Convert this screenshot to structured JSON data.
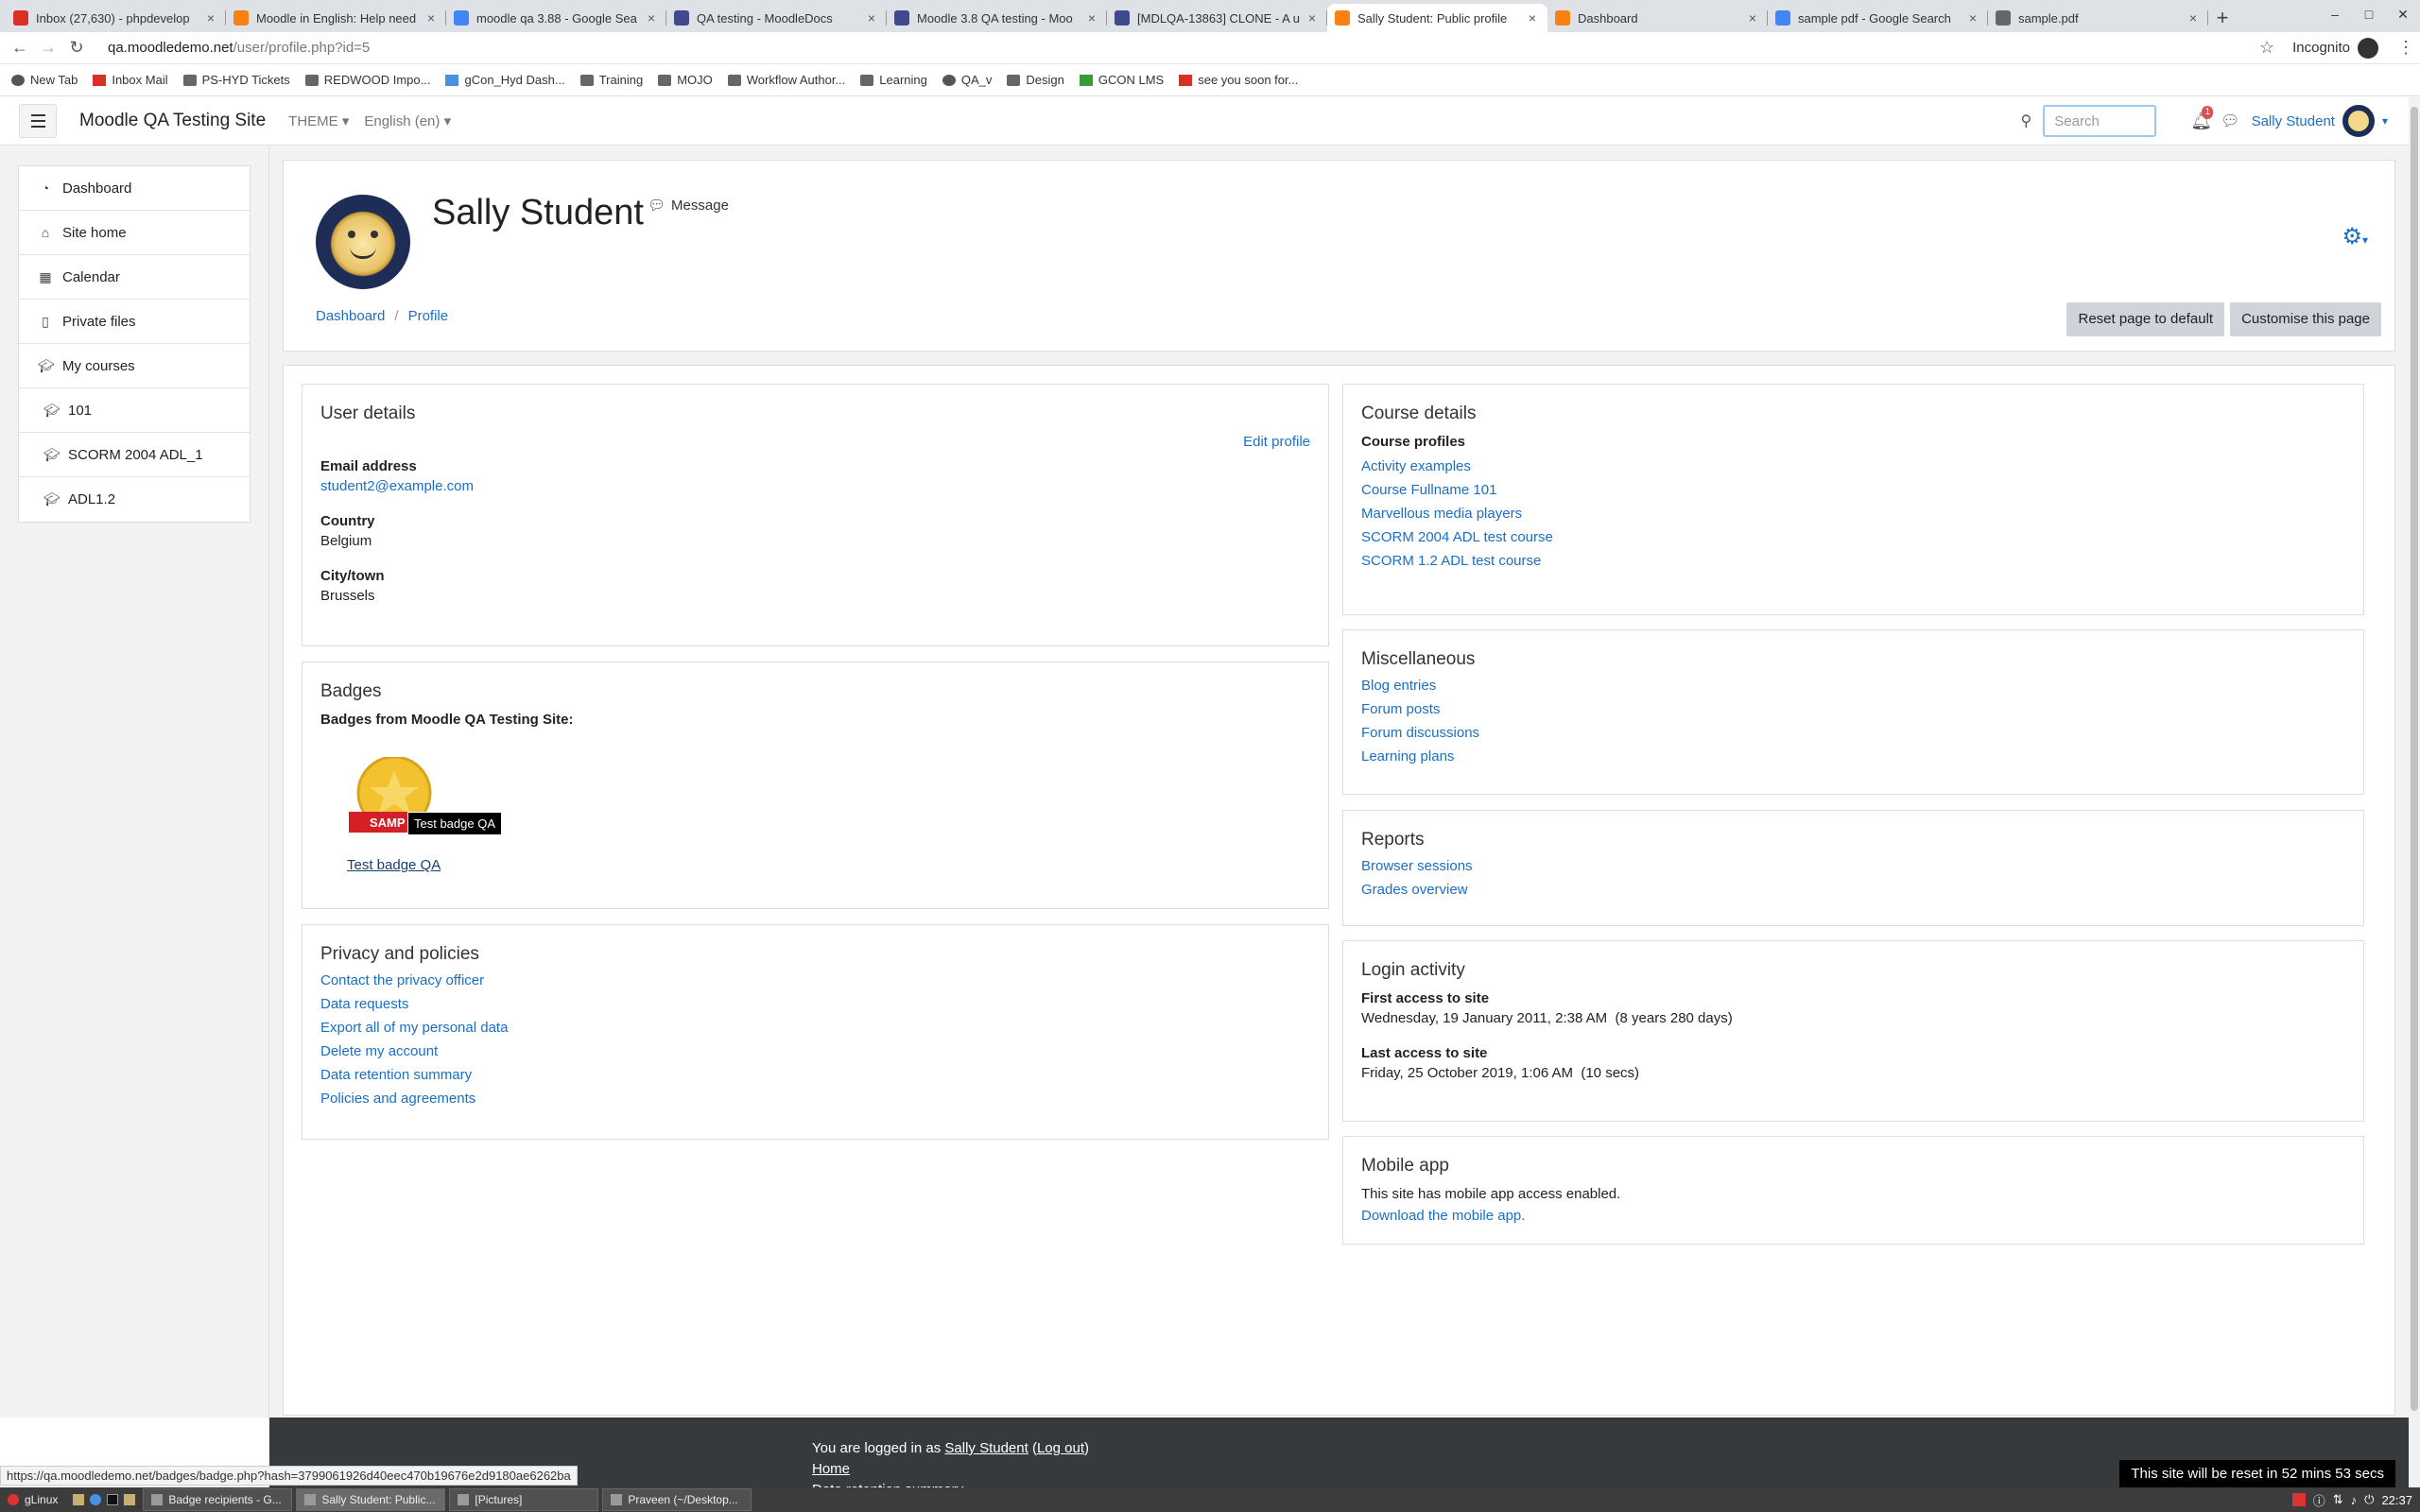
{
  "browser": {
    "tabs": [
      {
        "title": "Inbox (27,630) - phpdevelop",
        "icon": "gmail-icon",
        "color": "#d93025"
      },
      {
        "title": "Moodle in English: Help need",
        "icon": "moodle-icon",
        "color": "#f98012"
      },
      {
        "title": "moodle qa 3.88 - Google Sea",
        "icon": "google-icon",
        "color": "#4285f4"
      },
      {
        "title": "QA testing - MoodleDocs",
        "icon": "moodledocs-icon",
        "color": "#3e4a8c"
      },
      {
        "title": "Moodle 3.8 QA testing - Moo",
        "icon": "moodledocs-icon",
        "color": "#3e4a8c"
      },
      {
        "title": "[MDLQA-13863] CLONE - A u",
        "icon": "jira-icon",
        "color": "#3e4a8c"
      },
      {
        "title": "Sally Student: Public profile",
        "icon": "moodle-icon",
        "color": "#f98012",
        "active": true
      },
      {
        "title": "Dashboard",
        "icon": "moodle-icon",
        "color": "#f98012"
      },
      {
        "title": "sample pdf - Google Search",
        "icon": "google-icon",
        "color": "#4285f4"
      },
      {
        "title": "sample.pdf",
        "icon": "globe-icon",
        "color": "#666666"
      }
    ],
    "url_host": "qa.moodledemo.net",
    "url_path": "/user/profile.php?id=5",
    "incognito": "Incognito",
    "bookmarks": [
      "New Tab",
      "Inbox Mail",
      "PS-HYD Tickets",
      "REDWOOD Impo...",
      "gCon_Hyd Dash...",
      "Training",
      "MOJO",
      "Workflow Author...",
      "Learning",
      "QA_v",
      "Design",
      "GCON LMS",
      "see you soon for..."
    ]
  },
  "navbar": {
    "site_name": "Moodle QA Testing Site",
    "theme": "THEME",
    "language": "English (en)",
    "search_placeholder": "Search",
    "notif_count": "1",
    "user": "Sally Student"
  },
  "drawer": {
    "items": [
      "Dashboard",
      "Site home",
      "Calendar",
      "Private files",
      "My courses"
    ],
    "courses": [
      "101",
      "SCORM 2004 ADL_1",
      "ADL1.2"
    ]
  },
  "header": {
    "name": "Sally Student",
    "message": "Message",
    "breadcrumb": [
      "Dashboard",
      "Profile"
    ],
    "reset_btn": "Reset page to default",
    "customise_btn": "Customise this page"
  },
  "user_details": {
    "title": "User details",
    "edit": "Edit profile",
    "email_label": "Email address",
    "email": "student2@example.com",
    "country_label": "Country",
    "country": "Belgium",
    "city_label": "City/town",
    "city": "Brussels"
  },
  "badges": {
    "title": "Badges",
    "subtitle": "Badges from Moodle QA Testing Site:",
    "badge_name": "Test badge QA",
    "tooltip": "Test badge QA",
    "ribbon": "SAMP"
  },
  "privacy": {
    "title": "Privacy and policies",
    "links": [
      "Contact the privacy officer",
      "Data requests",
      "Export all of my personal data",
      "Delete my account",
      "Data retention summary",
      "Policies and agreements"
    ]
  },
  "course_details": {
    "title": "Course details",
    "label": "Course profiles",
    "links": [
      "Activity examples",
      "Course Fullname 101",
      "Marvellous media players",
      "SCORM 2004 ADL test course",
      "SCORM 1.2 ADL test course"
    ]
  },
  "misc": {
    "title": "Miscellaneous",
    "links": [
      "Blog entries",
      "Forum posts",
      "Forum discussions",
      "Learning plans"
    ]
  },
  "reports": {
    "title": "Reports",
    "links": [
      "Browser sessions",
      "Grades overview"
    ]
  },
  "login": {
    "title": "Login activity",
    "first_label": "First access to site",
    "first": "Wednesday, 19 January 2011, 2:38 AM  (8 years 280 days)",
    "last_label": "Last access to site",
    "last": "Friday, 25 October 2019, 1:06 AM  (10 secs)"
  },
  "mobile": {
    "title": "Mobile app",
    "text": "This site has mobile app access enabled.",
    "link": "Download the mobile app."
  },
  "footer": {
    "logged_prefix": "You are logged in as ",
    "user": "Sally Student",
    "logout": "Log out",
    "home": "Home",
    "retention": "Data retention summary",
    "reset_note": "This site will be reset in 52 mins 53 secs"
  },
  "status_url": "https://qa.moodledemo.net/badges/badge.php?hash=3799061926d40eec470b19676e2d9180ae6262ba",
  "taskbar": {
    "start": "gLinux",
    "tasks": [
      "Badge recipients - G...",
      "Sally Student: Public...",
      "[Pictures]",
      "Praveen (~/Desktop..."
    ],
    "clock": "22:37"
  }
}
